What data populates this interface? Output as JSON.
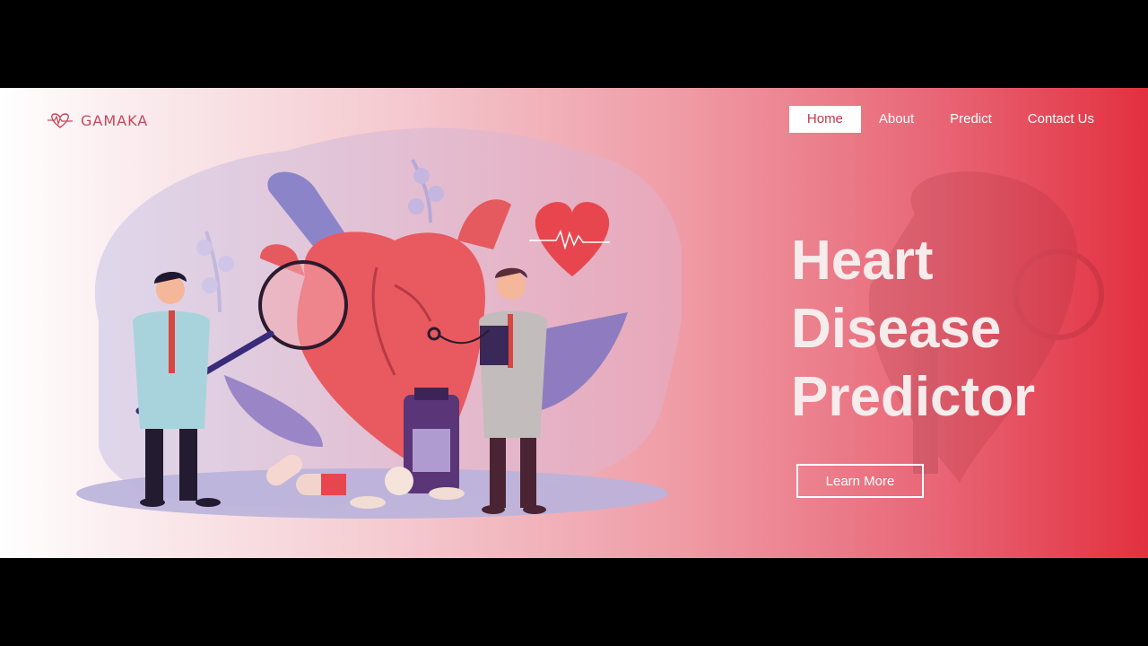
{
  "brand": {
    "name": "GAMAKA",
    "icon": "heart-pulse-icon"
  },
  "nav": {
    "items": [
      {
        "label": "Home",
        "active": true
      },
      {
        "label": "About",
        "active": false
      },
      {
        "label": "Predict",
        "active": false
      },
      {
        "label": "Contact Us",
        "active": false
      }
    ]
  },
  "hero": {
    "title_line1": "Heart",
    "title_line2": "Disease",
    "title_line3": "Predictor",
    "cta_label": "Learn More"
  },
  "colors": {
    "accent": "#e2303f",
    "heart": "#e85a5f",
    "nav_active_text": "#c0394c"
  }
}
